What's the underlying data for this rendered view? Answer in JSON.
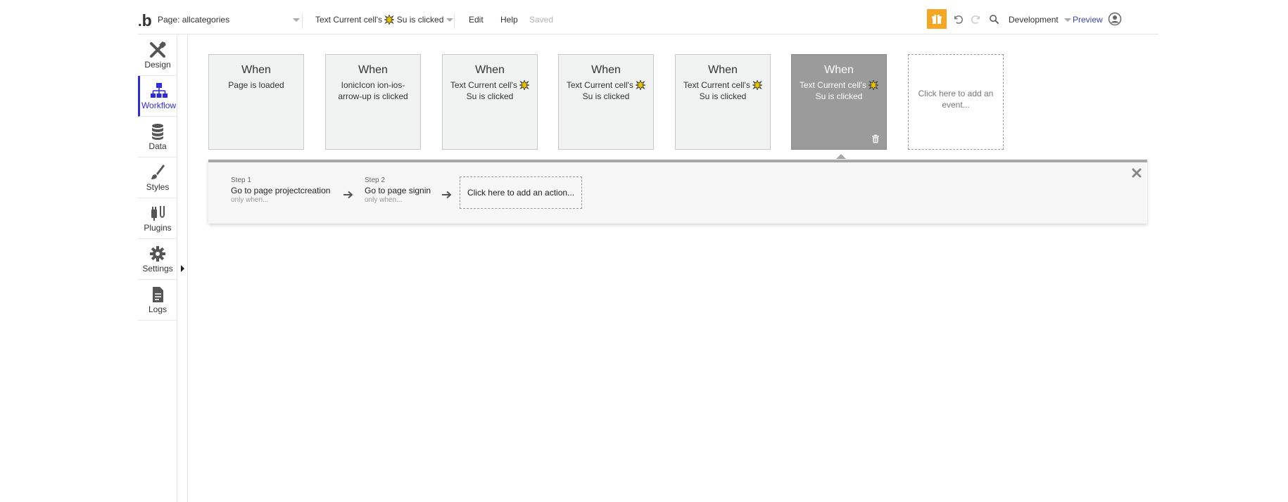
{
  "topbar": {
    "logo": "b",
    "page_select": "Page: allcategories",
    "event_select_prefix": "Text Current cell's",
    "event_select_suffix": "Su is clicked",
    "menu_edit": "Edit",
    "menu_help": "Help",
    "saved": "Saved",
    "environment": "Development",
    "preview": "Preview",
    "accent_color": "#f5a623",
    "preview_color": "#3546b9"
  },
  "sidebar": {
    "items": [
      {
        "label": "Design",
        "icon": "design-icon"
      },
      {
        "label": "Workflow",
        "icon": "workflow-icon"
      },
      {
        "label": "Data",
        "icon": "database-icon"
      },
      {
        "label": "Styles",
        "icon": "brush-icon"
      },
      {
        "label": "Plugins",
        "icon": "plug-icon"
      },
      {
        "label": "Settings",
        "icon": "gear-icon"
      },
      {
        "label": "Logs",
        "icon": "document-icon"
      }
    ],
    "active": "Workflow",
    "active_color": "#2d2cdb"
  },
  "events": [
    {
      "when": "When",
      "desc_lines": [
        "Page is loaded"
      ]
    },
    {
      "when": "When",
      "desc_lines": [
        "IonicIcon ion-ios-",
        "arrow-up is clicked"
      ]
    },
    {
      "when": "When",
      "desc_lines": [
        "Text Current cell's",
        "Su is clicked"
      ]
    },
    {
      "when": "When",
      "desc_lines": [
        "Text Current cell's",
        "Su is clicked"
      ]
    },
    {
      "when": "When",
      "desc_lines": [
        "Text Current cell's",
        "Su is clicked"
      ]
    },
    {
      "when": "When",
      "desc_lines": [
        "Text Current cell's",
        "Su is clicked"
      ],
      "selected": true
    }
  ],
  "add_event": {
    "line1": "Click here to add an",
    "line2": "event..."
  },
  "actions": {
    "steps": [
      {
        "label": "Step 1",
        "name": "Go to page projectcreation",
        "cond": "only when..."
      },
      {
        "label": "Step 2",
        "name": "Go to page signin",
        "cond": "only when..."
      }
    ],
    "add_action": "Click here to add an action..."
  }
}
